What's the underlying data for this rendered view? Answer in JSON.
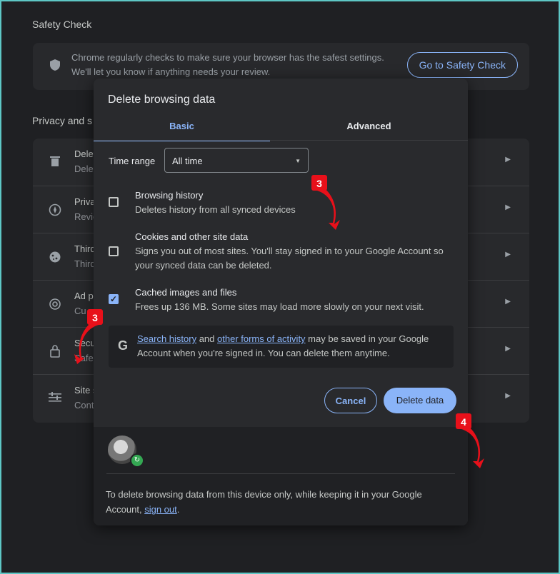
{
  "background": {
    "safety_check_title": "Safety Check",
    "safety_check_text_1": "Chrome regularly checks to make sure your browser has the safest settings.",
    "safety_check_text_2": "We'll let you know if anything needs your review.",
    "safety_check_button": "Go to Safety Check",
    "privacy_title": "Privacy and s",
    "rows": [
      {
        "t1": "Delet",
        "t2": "Delet",
        "icon": "trash-icon"
      },
      {
        "t1": "Priva",
        "t2": "Revie",
        "icon": "compass-icon"
      },
      {
        "t1": "Third",
        "t2": "Third",
        "icon": "cookie-icon"
      },
      {
        "t1": "Ad p",
        "t2": "Cu",
        "icon": "ad-privacy-icon"
      },
      {
        "t1": "Secu",
        "t2": "Safe",
        "icon": "lock-icon"
      },
      {
        "t1": "Site s",
        "t2": "Cont",
        "icon": "sliders-icon"
      }
    ]
  },
  "dialog": {
    "title": "Delete browsing data",
    "tabs": [
      "Basic",
      "Advanced"
    ],
    "time_range_label": "Time range",
    "time_range_value": "All time",
    "options": [
      {
        "title": "Browsing history",
        "desc": "Deletes history from all synced devices",
        "checked": false
      },
      {
        "title": "Cookies and other site data",
        "desc": "Signs you out of most sites. You'll stay signed in to your Google Account so your synced data can be deleted.",
        "checked": false
      },
      {
        "title": "Cached images and files",
        "desc": "Frees up 136 MB. Some sites may load more slowly on your next visit.",
        "checked": true
      }
    ],
    "google_notice": {
      "link1": "Search history",
      "mid": " and ",
      "link2": "other forms of activity",
      "rest": " may be saved in your Google Account when you're signed in. You can delete them anytime."
    },
    "cancel_label": "Cancel",
    "delete_label": "Delete data",
    "footer_text": "To delete browsing data from this device only, while keeping it in your Google Account, ",
    "footer_link": "sign out",
    "footer_end": "."
  },
  "annotations": [
    "3",
    "3",
    "4"
  ],
  "colors": {
    "accent": "#8ab4f8",
    "annotation": "#e8101a"
  }
}
